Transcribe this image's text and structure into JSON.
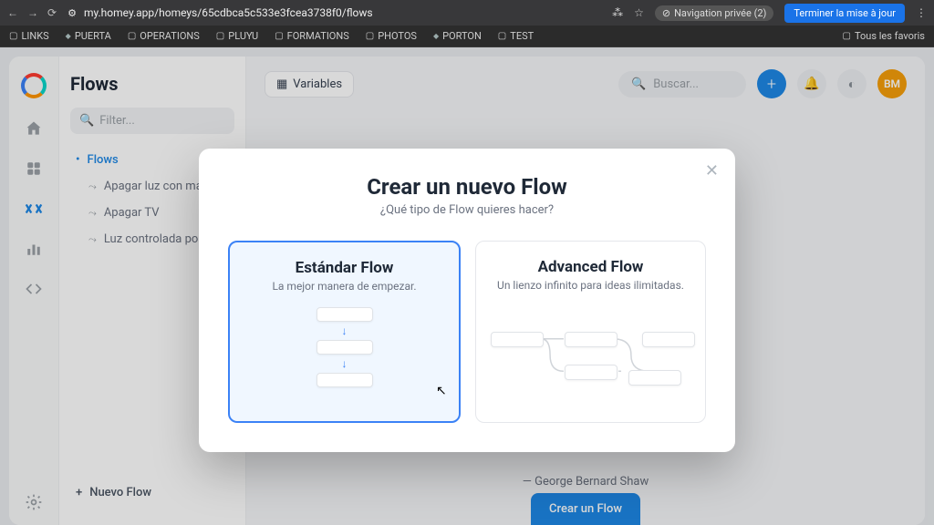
{
  "browser": {
    "url": "my.homey.app/homeys/65cdbca5c533e3fcea3738f0/flows",
    "private_label": "Navigation privée (2)",
    "update_label": "Terminer la mise à jour"
  },
  "bookmarks": {
    "items": [
      "LINKS",
      "PUERTA",
      "OPERATIONS",
      "PLUYU",
      "FORMATIONS",
      "PHOTOS",
      "PORTON",
      "TEST"
    ],
    "all_favs": "Tous les favoris"
  },
  "sidebar": {
    "title": "Flows",
    "filter_placeholder": "Filter...",
    "root_label": "Flows",
    "items": [
      "Apagar luz con mando",
      "Apagar TV",
      "Luz controlada por m…"
    ],
    "new_flow": "Nuevo Flow"
  },
  "topbar": {
    "variables": "Variables",
    "search_placeholder": "Buscar...",
    "avatar": "BM"
  },
  "quote_author": "— George Bernard Shaw",
  "cta": "Crear un Flow",
  "modal": {
    "title": "Crear un nuevo Flow",
    "subtitle": "¿Qué tipo de Flow quieres hacer?",
    "standard": {
      "title": "Estándar Flow",
      "desc": "La mejor manera de empezar."
    },
    "advanced": {
      "title": "Advanced Flow",
      "desc": "Un lienzo infinito para ideas ilimitadas."
    }
  }
}
